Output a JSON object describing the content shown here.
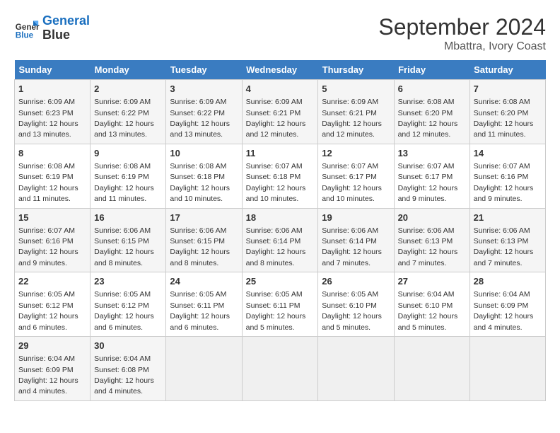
{
  "logo": {
    "line1": "General",
    "line2": "Blue"
  },
  "title": "September 2024",
  "location": "Mbattra, Ivory Coast",
  "days_of_week": [
    "Sunday",
    "Monday",
    "Tuesday",
    "Wednesday",
    "Thursday",
    "Friday",
    "Saturday"
  ],
  "weeks": [
    [
      {
        "day": 1,
        "sunrise": "6:09 AM",
        "sunset": "6:23 PM",
        "daylight": "12 hours and 13 minutes."
      },
      {
        "day": 2,
        "sunrise": "6:09 AM",
        "sunset": "6:22 PM",
        "daylight": "12 hours and 13 minutes."
      },
      {
        "day": 3,
        "sunrise": "6:09 AM",
        "sunset": "6:22 PM",
        "daylight": "12 hours and 13 minutes."
      },
      {
        "day": 4,
        "sunrise": "6:09 AM",
        "sunset": "6:21 PM",
        "daylight": "12 hours and 12 minutes."
      },
      {
        "day": 5,
        "sunrise": "6:09 AM",
        "sunset": "6:21 PM",
        "daylight": "12 hours and 12 minutes."
      },
      {
        "day": 6,
        "sunrise": "6:08 AM",
        "sunset": "6:20 PM",
        "daylight": "12 hours and 12 minutes."
      },
      {
        "day": 7,
        "sunrise": "6:08 AM",
        "sunset": "6:20 PM",
        "daylight": "12 hours and 11 minutes."
      }
    ],
    [
      {
        "day": 8,
        "sunrise": "6:08 AM",
        "sunset": "6:19 PM",
        "daylight": "12 hours and 11 minutes."
      },
      {
        "day": 9,
        "sunrise": "6:08 AM",
        "sunset": "6:19 PM",
        "daylight": "12 hours and 11 minutes."
      },
      {
        "day": 10,
        "sunrise": "6:08 AM",
        "sunset": "6:18 PM",
        "daylight": "12 hours and 10 minutes."
      },
      {
        "day": 11,
        "sunrise": "6:07 AM",
        "sunset": "6:18 PM",
        "daylight": "12 hours and 10 minutes."
      },
      {
        "day": 12,
        "sunrise": "6:07 AM",
        "sunset": "6:17 PM",
        "daylight": "12 hours and 10 minutes."
      },
      {
        "day": 13,
        "sunrise": "6:07 AM",
        "sunset": "6:17 PM",
        "daylight": "12 hours and 9 minutes."
      },
      {
        "day": 14,
        "sunrise": "6:07 AM",
        "sunset": "6:16 PM",
        "daylight": "12 hours and 9 minutes."
      }
    ],
    [
      {
        "day": 15,
        "sunrise": "6:07 AM",
        "sunset": "6:16 PM",
        "daylight": "12 hours and 9 minutes."
      },
      {
        "day": 16,
        "sunrise": "6:06 AM",
        "sunset": "6:15 PM",
        "daylight": "12 hours and 8 minutes."
      },
      {
        "day": 17,
        "sunrise": "6:06 AM",
        "sunset": "6:15 PM",
        "daylight": "12 hours and 8 minutes."
      },
      {
        "day": 18,
        "sunrise": "6:06 AM",
        "sunset": "6:14 PM",
        "daylight": "12 hours and 8 minutes."
      },
      {
        "day": 19,
        "sunrise": "6:06 AM",
        "sunset": "6:14 PM",
        "daylight": "12 hours and 7 minutes."
      },
      {
        "day": 20,
        "sunrise": "6:06 AM",
        "sunset": "6:13 PM",
        "daylight": "12 hours and 7 minutes."
      },
      {
        "day": 21,
        "sunrise": "6:06 AM",
        "sunset": "6:13 PM",
        "daylight": "12 hours and 7 minutes."
      }
    ],
    [
      {
        "day": 22,
        "sunrise": "6:05 AM",
        "sunset": "6:12 PM",
        "daylight": "12 hours and 6 minutes."
      },
      {
        "day": 23,
        "sunrise": "6:05 AM",
        "sunset": "6:12 PM",
        "daylight": "12 hours and 6 minutes."
      },
      {
        "day": 24,
        "sunrise": "6:05 AM",
        "sunset": "6:11 PM",
        "daylight": "12 hours and 6 minutes."
      },
      {
        "day": 25,
        "sunrise": "6:05 AM",
        "sunset": "6:11 PM",
        "daylight": "12 hours and 5 minutes."
      },
      {
        "day": 26,
        "sunrise": "6:05 AM",
        "sunset": "6:10 PM",
        "daylight": "12 hours and 5 minutes."
      },
      {
        "day": 27,
        "sunrise": "6:04 AM",
        "sunset": "6:10 PM",
        "daylight": "12 hours and 5 minutes."
      },
      {
        "day": 28,
        "sunrise": "6:04 AM",
        "sunset": "6:09 PM",
        "daylight": "12 hours and 4 minutes."
      }
    ],
    [
      {
        "day": 29,
        "sunrise": "6:04 AM",
        "sunset": "6:09 PM",
        "daylight": "12 hours and 4 minutes."
      },
      {
        "day": 30,
        "sunrise": "6:04 AM",
        "sunset": "6:08 PM",
        "daylight": "12 hours and 4 minutes."
      },
      null,
      null,
      null,
      null,
      null
    ]
  ]
}
